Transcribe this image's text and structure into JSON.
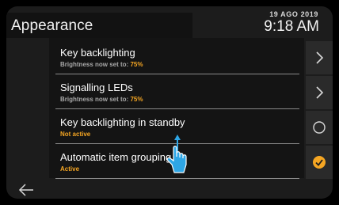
{
  "header": {
    "title": "Appearance",
    "date": "19 AGO 2019",
    "time": "9:18 AM"
  },
  "colors": {
    "accent": "#f5a623",
    "highlight_blue": "#2ea6e6"
  },
  "settings": [
    {
      "label": "Key backlighting",
      "subtitle_prefix": "Brightness now set to: ",
      "subtitle_value": "75%",
      "control": "chevron-right-icon"
    },
    {
      "label": "Signalling LEDs",
      "subtitle_prefix": "Brightness now set to: ",
      "subtitle_value": "75%",
      "control": "chevron-right-icon"
    },
    {
      "label": "Key backlighting in standby",
      "subtitle_value": "Not active",
      "control": "radio-unchecked-icon",
      "checked": false
    },
    {
      "label": "Automatic item grouping",
      "subtitle_value": "Active",
      "control": "radio-checked-icon",
      "checked": true
    }
  ],
  "footer": {
    "back_icon": "back-arrow-icon"
  },
  "overlay": {
    "gesture_icon": "swipe-up-hand-icon"
  }
}
